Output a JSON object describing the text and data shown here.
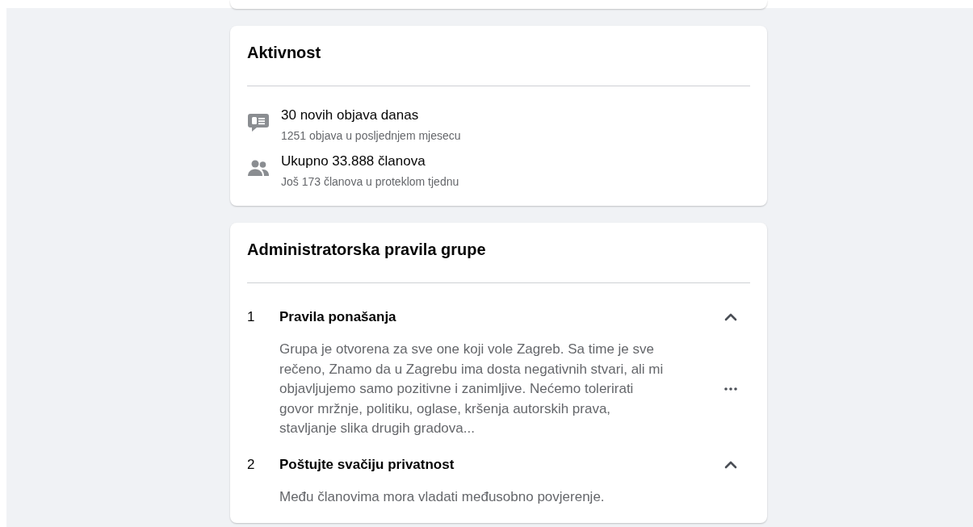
{
  "activity": {
    "title": "Aktivnost",
    "items": [
      {
        "kind": "posts",
        "main": "30 novih objava danas",
        "sub": "1251 objava u posljednjem mjesecu"
      },
      {
        "kind": "members",
        "main": "Ukupno 33.888 članova",
        "sub": "Još 173 članova u proteklom tjednu"
      }
    ]
  },
  "rules": {
    "title": "Administratorska pravila grupe",
    "items": [
      {
        "number": "1",
        "title": "Pravila ponašanja",
        "expanded": true,
        "more": true,
        "body": "Grupa je otvorena za sve one koji vole Zagreb. Sa time je sve rečeno, Znamo da u Zagrebu ima dosta negativnih stvari, ali mi objavljujemo samo pozitivne i zanimljive. Nećemo tolerirati govor mržnje, politiku, oglase, kršenja autorskih prava, stavljanje slika drugih gradova..."
      },
      {
        "number": "2",
        "title": "Poštujte svačiju privatnost",
        "expanded": true,
        "more": false,
        "body": "Među članovima mora vladati međusobno povjerenje."
      }
    ]
  }
}
